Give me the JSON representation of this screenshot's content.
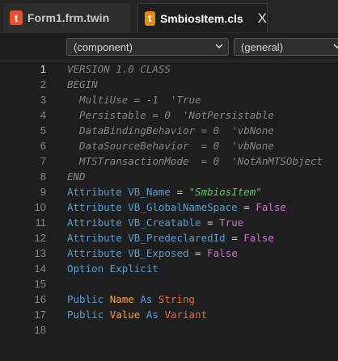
{
  "tabs": [
    {
      "icon": "t",
      "label": "Form1.frm.twin",
      "active": false
    },
    {
      "icon": "t",
      "label": "SmbiosItem.cls",
      "active": true,
      "close": "X"
    }
  ],
  "dropdowns": {
    "component": "(component)",
    "general": "(general)"
  },
  "editor": {
    "current_line": 1,
    "lines": [
      {
        "n": "1"
      },
      {
        "n": "2"
      },
      {
        "n": "3"
      },
      {
        "n": "4"
      },
      {
        "n": "5"
      },
      {
        "n": "6"
      },
      {
        "n": "7"
      },
      {
        "n": "8"
      },
      {
        "n": "9"
      },
      {
        "n": "10"
      },
      {
        "n": "11"
      },
      {
        "n": "12"
      },
      {
        "n": "13"
      },
      {
        "n": "14"
      },
      {
        "n": "15"
      },
      {
        "n": "16"
      },
      {
        "n": "17"
      },
      {
        "n": "18"
      }
    ],
    "code": {
      "l1": "VERSION 1.0 CLASS",
      "l2": "BEGIN",
      "l3": "  MultiUse = -1  'True",
      "l4": "  Persistable = 0  'NotPersistable",
      "l5": "  DataBindingBehavior = 0  'vbNone",
      "l6": "  DataSourceBehavior  = 0  'vbNone",
      "l7": "  MTSTransactionMode  = 0  'NotAnMTSObject",
      "l8": "END",
      "l9": {
        "kw": "Attribute VB_Name",
        "eq": " = ",
        "val": "\"SmbiosItem\""
      },
      "l10": {
        "kw": "Attribute VB_GlobalNameSpace",
        "eq": " = ",
        "val": "False"
      },
      "l11": {
        "kw": "Attribute VB_Creatable",
        "eq": " = ",
        "val": "True"
      },
      "l12": {
        "kw": "Attribute VB_PredeclaredId",
        "eq": " = ",
        "val": "False"
      },
      "l13": {
        "kw": "Attribute VB_Exposed",
        "eq": " = ",
        "val": "False"
      },
      "l14": "Option Explicit",
      "l16": {
        "kw1": "Public",
        "name": "Name",
        "kw2": "As",
        "type": "String"
      },
      "l17": {
        "kw1": "Public",
        "name": "Value",
        "kw2": "As",
        "type": "Variant"
      }
    }
  },
  "colors": {
    "background": "#1e1e1e",
    "keyword": "#569cd6",
    "comment": "#858585",
    "boolean": "#d070d0",
    "string": "#50d050",
    "identifier": "#ff9e3d",
    "type": "#e06c3c",
    "twin_icon": "#e8522f"
  }
}
